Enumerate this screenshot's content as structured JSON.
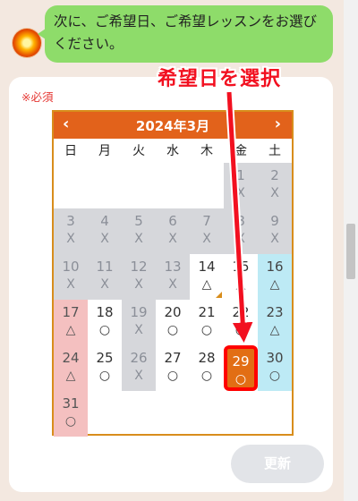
{
  "chat": {
    "message": "次に、ご希望日、ご希望レッスンをお選びください。"
  },
  "form": {
    "required_label": "※必須",
    "update_label": "更新"
  },
  "calendar": {
    "title": "2024年3月",
    "prev_icon": "‹",
    "next_icon": "›",
    "weekdays": [
      "日",
      "月",
      "火",
      "水",
      "木",
      "金",
      "土"
    ],
    "days": [
      {
        "day": "1",
        "mark": "X",
        "state": "disabled"
      },
      {
        "day": "2",
        "mark": "X",
        "state": "disabled"
      },
      {
        "day": "3",
        "mark": "X",
        "state": "disabled"
      },
      {
        "day": "4",
        "mark": "X",
        "state": "disabled"
      },
      {
        "day": "5",
        "mark": "X",
        "state": "disabled"
      },
      {
        "day": "6",
        "mark": "X",
        "state": "disabled"
      },
      {
        "day": "7",
        "mark": "X",
        "state": "disabled"
      },
      {
        "day": "8",
        "mark": "X",
        "state": "disabled"
      },
      {
        "day": "9",
        "mark": "X",
        "state": "disabled"
      },
      {
        "day": "10",
        "mark": "X",
        "state": "disabled"
      },
      {
        "day": "11",
        "mark": "X",
        "state": "disabled"
      },
      {
        "day": "12",
        "mark": "X",
        "state": "disabled"
      },
      {
        "day": "13",
        "mark": "X",
        "state": "disabled"
      },
      {
        "day": "14",
        "mark": "△",
        "state": "open"
      },
      {
        "day": "15",
        "mark": "△",
        "state": "open"
      },
      {
        "day": "16",
        "mark": "△",
        "state": "sat"
      },
      {
        "day": "17",
        "mark": "△",
        "state": "sun"
      },
      {
        "day": "18",
        "mark": "○",
        "state": "open"
      },
      {
        "day": "19",
        "mark": "X",
        "state": "disabled"
      },
      {
        "day": "20",
        "mark": "○",
        "state": "open"
      },
      {
        "day": "21",
        "mark": "○",
        "state": "open"
      },
      {
        "day": "22",
        "mark": "○",
        "state": "open"
      },
      {
        "day": "23",
        "mark": "△",
        "state": "sat"
      },
      {
        "day": "24",
        "mark": "△",
        "state": "sun"
      },
      {
        "day": "25",
        "mark": "○",
        "state": "open"
      },
      {
        "day": "26",
        "mark": "X",
        "state": "disabled"
      },
      {
        "day": "27",
        "mark": "○",
        "state": "open"
      },
      {
        "day": "28",
        "mark": "○",
        "state": "open"
      },
      {
        "day": "29",
        "mark": "○",
        "state": "selected"
      },
      {
        "day": "30",
        "mark": "○",
        "state": "sat"
      },
      {
        "day": "31",
        "mark": "○",
        "state": "sun"
      }
    ]
  },
  "annotation": {
    "text": "希望日を選択"
  },
  "colors": {
    "header": "#e2621b",
    "selected": "#e26e14",
    "highlight_border": "#ff0000",
    "disabled_bg": "#d6d7db",
    "sunday_bg": "#f4c0c0",
    "saturday_bg": "#bdeaf5"
  }
}
